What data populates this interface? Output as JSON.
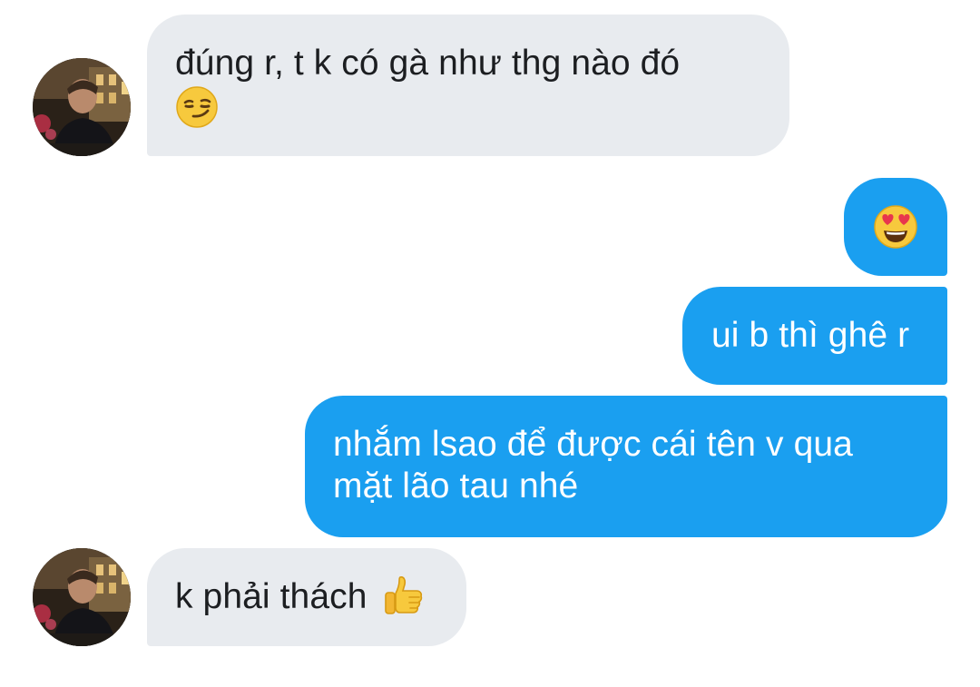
{
  "colors": {
    "incoming_bubble": "#e8ebef",
    "outgoing_bubble": "#1a9ff0",
    "incoming_text": "#1c1e21",
    "outgoing_text": "#ffffff"
  },
  "messages": [
    {
      "sender": "contact",
      "text": "đúng r, t k có gà như thg nào đó",
      "emoji": "smirking-face-emoji"
    },
    {
      "sender": "me",
      "text": "",
      "emoji": "heart-eyes-emoji"
    },
    {
      "sender": "me",
      "text": "ui b thì ghê r"
    },
    {
      "sender": "me",
      "text_line1": "nhắm lsao để được cái tên v qua",
      "text_line2": "mặt lão tau nhé"
    },
    {
      "sender": "contact",
      "text": "k phải thách",
      "emoji": "thumbs-up-emoji"
    }
  ]
}
